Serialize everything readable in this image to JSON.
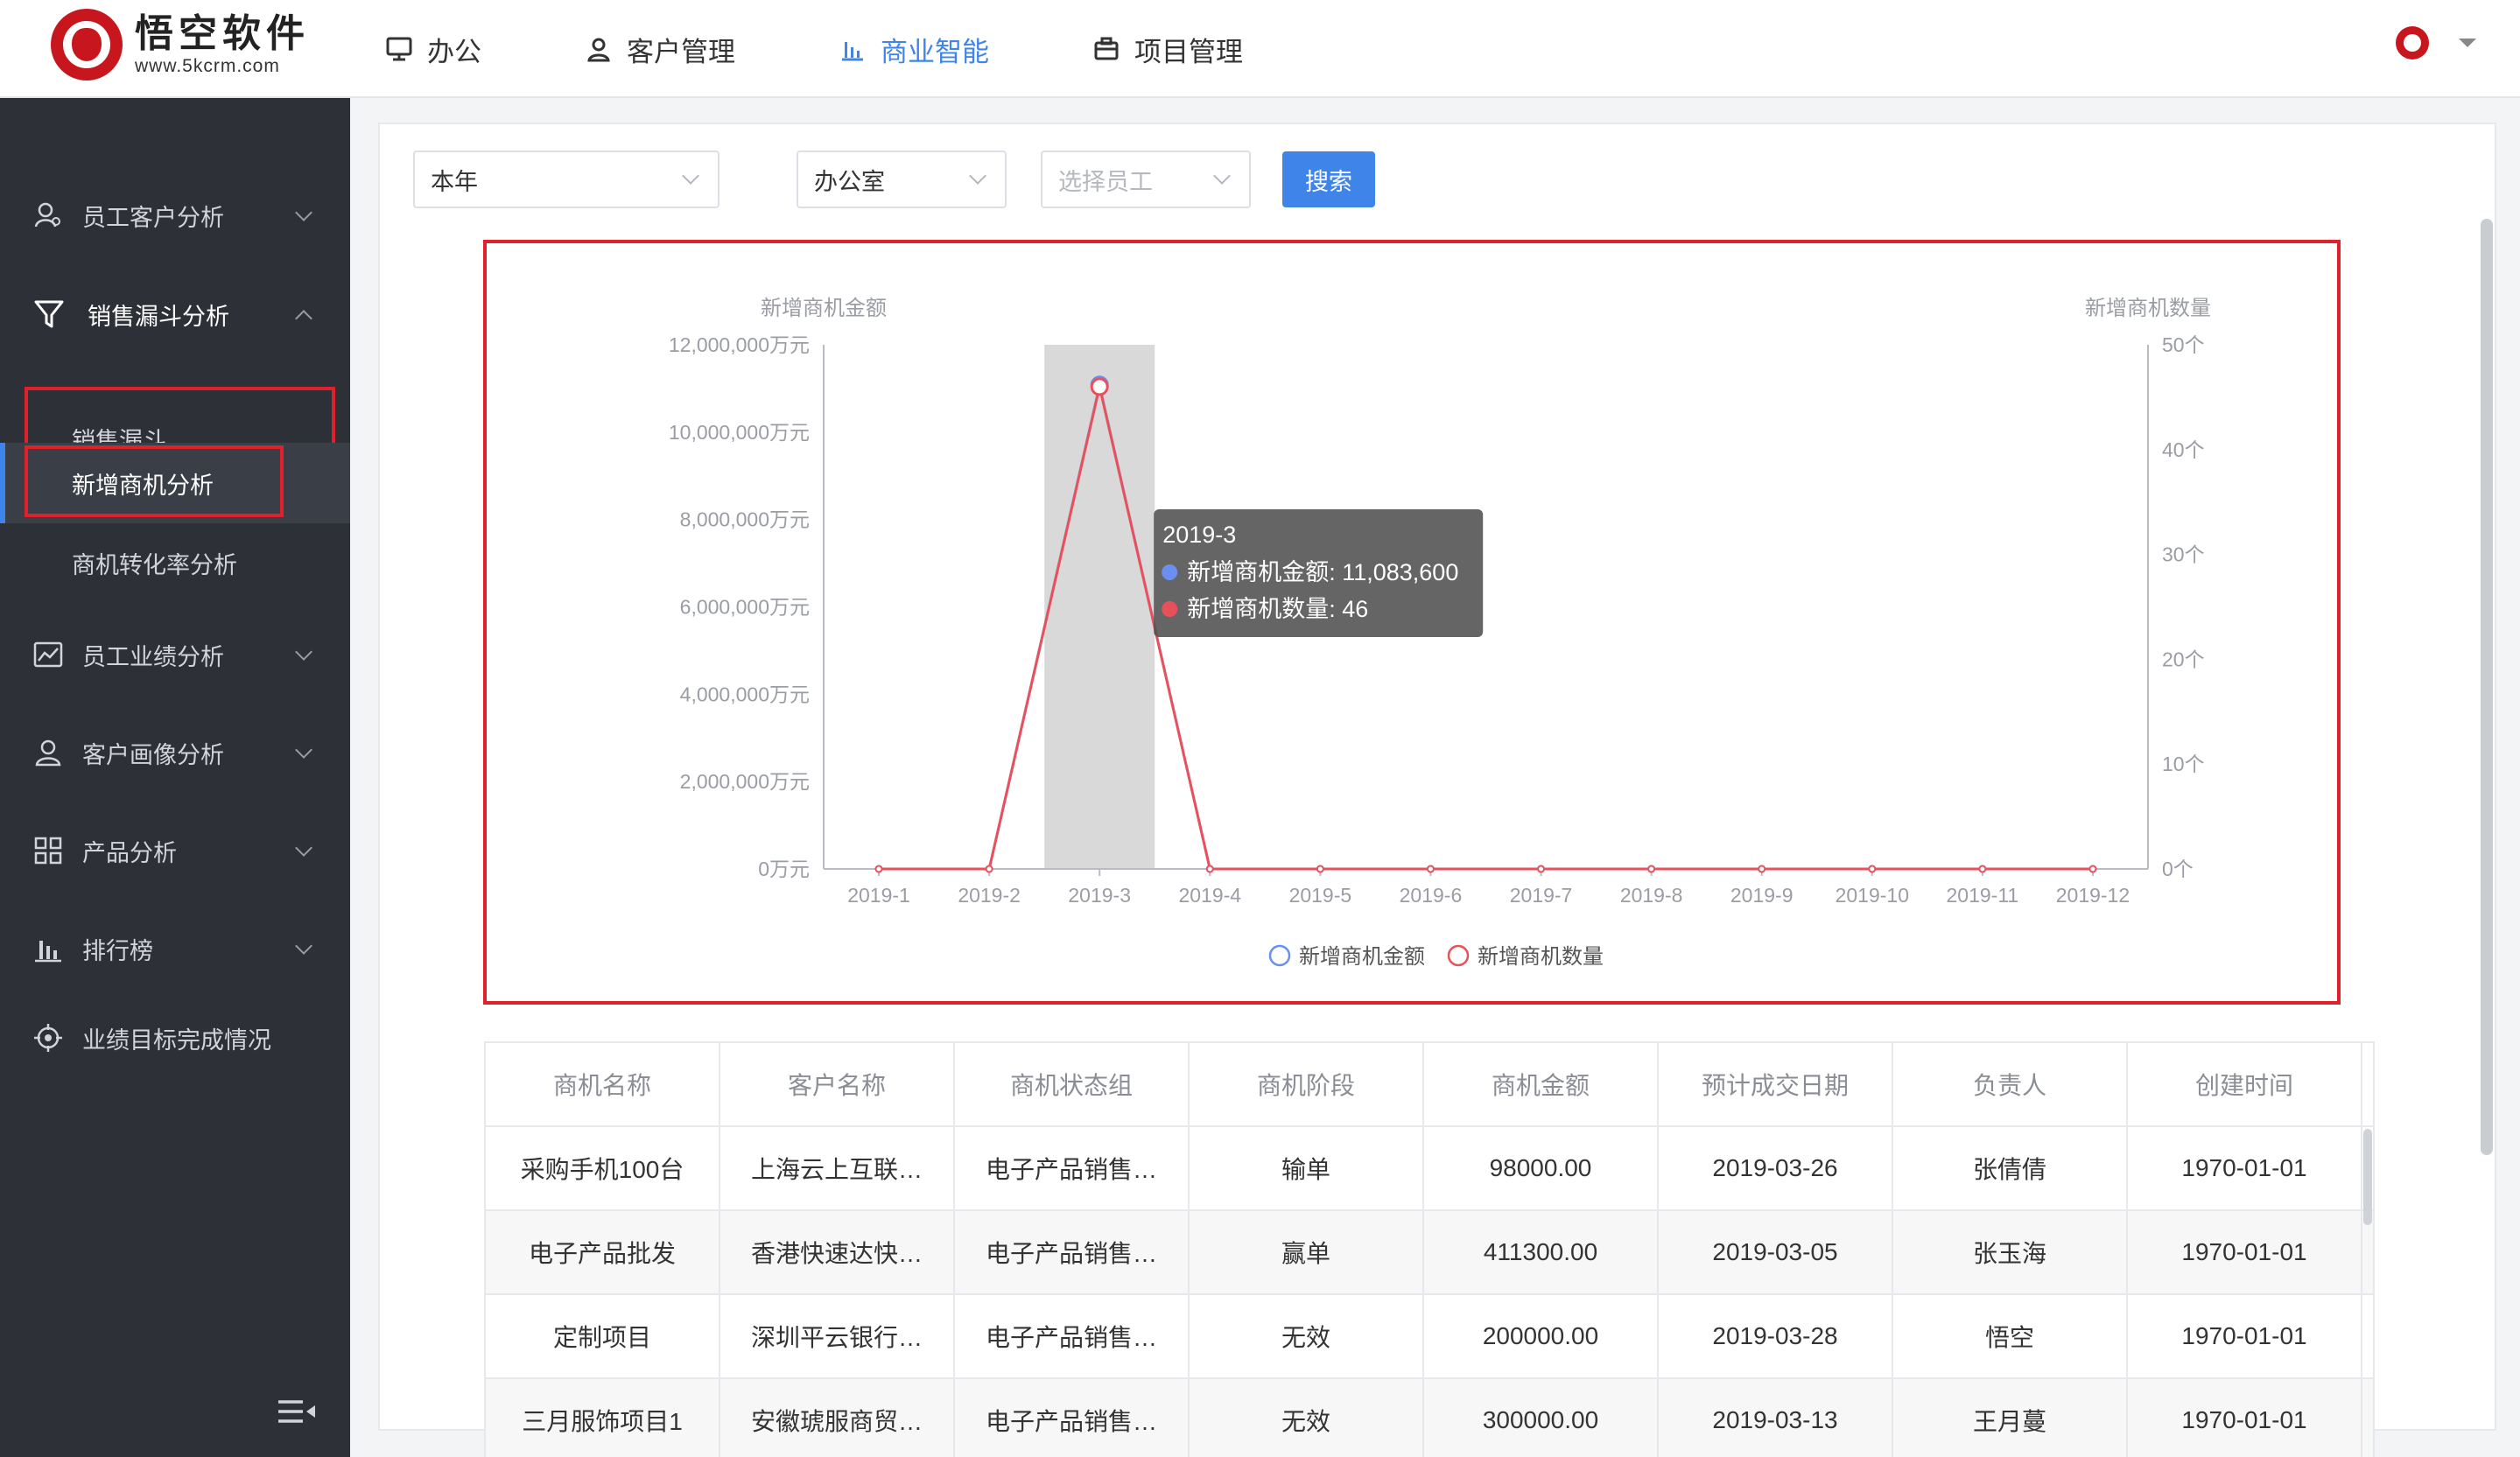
{
  "brand": {
    "title": "悟空软件",
    "subtitle": "www.5kcrm.com"
  },
  "nav": [
    {
      "label": "办公",
      "icon": "monitor-icon"
    },
    {
      "label": "客户管理",
      "icon": "user-icon"
    },
    {
      "label": "商业智能",
      "icon": "bar-chart-icon",
      "active": true
    },
    {
      "label": "项目管理",
      "icon": "briefcase-icon"
    }
  ],
  "sidebar": {
    "items": [
      {
        "label": "员工客户分析",
        "icon": "user-analysis-icon"
      },
      {
        "label": "销售漏斗分析",
        "icon": "funnel-icon",
        "expanded": true
      },
      {
        "label": "员工业绩分析",
        "icon": "trend-icon"
      },
      {
        "label": "客户画像分析",
        "icon": "portrait-icon"
      },
      {
        "label": "产品分析",
        "icon": "grid-icon"
      },
      {
        "label": "排行榜",
        "icon": "ranking-icon"
      },
      {
        "label": "业绩目标完成情况",
        "icon": "target-icon"
      }
    ],
    "sub_items": [
      {
        "label": "销售漏斗"
      },
      {
        "label": "新增商机分析",
        "active": true
      },
      {
        "label": "商机转化率分析"
      }
    ]
  },
  "filters": {
    "period": "本年",
    "department": "办公室",
    "employee_placeholder": "选择员工",
    "search_label": "搜索"
  },
  "chart_data": {
    "type": "line",
    "categories": [
      "2019-1",
      "2019-2",
      "2019-3",
      "2019-4",
      "2019-5",
      "2019-6",
      "2019-7",
      "2019-8",
      "2019-9",
      "2019-10",
      "2019-11",
      "2019-12"
    ],
    "series": [
      {
        "name": "新增商机金额",
        "axis": "left",
        "color": "#6b8ff0",
        "values": [
          0,
          0,
          11083600,
          0,
          0,
          0,
          0,
          0,
          0,
          0,
          0,
          0
        ]
      },
      {
        "name": "新增商机数量",
        "axis": "right",
        "color": "#e8505b",
        "values": [
          0,
          0,
          46,
          0,
          0,
          0,
          0,
          0,
          0,
          0,
          0,
          0
        ]
      }
    ],
    "y_left": {
      "label": "新增商机金额",
      "ylim": [
        0,
        12000000
      ],
      "ticks": [
        "0万元",
        "2,000,000万元",
        "4,000,000万元",
        "6,000,000万元",
        "8,000,000万元",
        "10,000,000万元",
        "12,000,000万元"
      ]
    },
    "y_right": {
      "label": "新增商机数量",
      "ylim": [
        0,
        50
      ],
      "ticks": [
        "0个",
        "10个",
        "20个",
        "30个",
        "40个",
        "50个"
      ]
    },
    "tooltip": {
      "title": "2019-3",
      "lines": [
        "新增商机金额: 11,083,600",
        "新增商机数量: 46"
      ]
    },
    "legend": [
      "新增商机金额",
      "新增商机数量"
    ],
    "legend_position": "bottom-center",
    "highlighted_category": "2019-3"
  },
  "table": {
    "headers": [
      "商机名称",
      "客户名称",
      "商机状态组",
      "商机阶段",
      "商机金额",
      "预计成交日期",
      "负责人",
      "创建时间"
    ],
    "rows": [
      [
        "采购手机100台",
        "上海云上互联…",
        "电子产品销售…",
        "输单",
        "98000.00",
        "2019-03-26",
        "张倩倩",
        "1970-01-01"
      ],
      [
        "电子产品批发",
        "香港快速达快…",
        "电子产品销售…",
        "赢单",
        "411300.00",
        "2019-03-05",
        "张玉海",
        "1970-01-01"
      ],
      [
        "定制项目",
        "深圳平云银行…",
        "电子产品销售…",
        "无效",
        "200000.00",
        "2019-03-28",
        "悟空",
        "1970-01-01"
      ],
      [
        "三月服饰项目1",
        "安徽琥服商贸…",
        "电子产品销售…",
        "无效",
        "300000.00",
        "2019-03-13",
        "王月蔓",
        "1970-01-01"
      ]
    ]
  }
}
